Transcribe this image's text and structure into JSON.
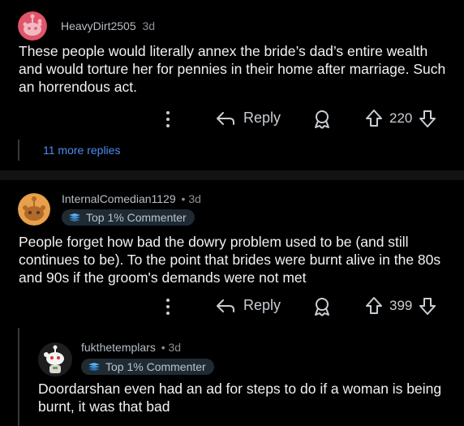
{
  "comments": [
    {
      "username": "HeavyDirt2505",
      "age": "3d",
      "body": "These people would literally annex the bride’s dad’s entire wealth and would torture her for pennies in their home after marriage. Such an horrendous act.",
      "reply_label": "Reply",
      "votes": "220",
      "more_replies": "11 more replies"
    },
    {
      "username": "InternalComedian1129",
      "age": "3d",
      "flair": "Top 1% Commenter",
      "body": "People forget how bad the dowry problem used to be (and still continues to be). To the point that brides were burnt alive in the 80s and 90s  if the groom's demands were not met",
      "reply_label": "Reply",
      "votes": "399"
    },
    {
      "username": "fukthetemplars",
      "age": "3d",
      "flair": "Top 1% Commenter",
      "body": "Doordarshan even had an ad for steps to do if a woman is being burnt, it was that bad"
    }
  ],
  "separator_dot": "•",
  "colors": {
    "link": "#4a8ef0",
    "background": "#000000",
    "flair_bg": "#1f2a33"
  },
  "icons": [
    "more-options-icon",
    "reply-arrow-icon",
    "award-icon",
    "upvote-icon",
    "downvote-icon",
    "top-commenter-icon"
  ]
}
